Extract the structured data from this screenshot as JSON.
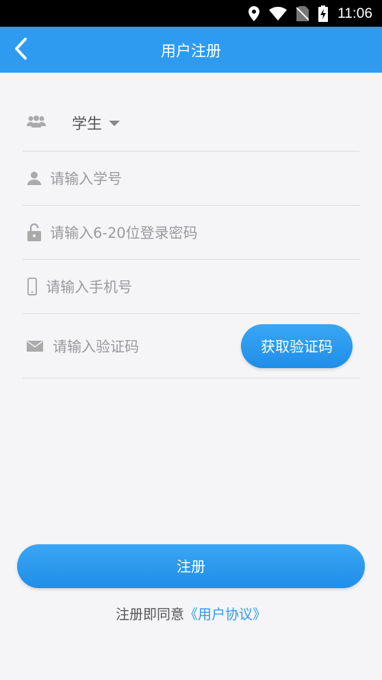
{
  "status_bar": {
    "time": "11:06"
  },
  "app_bar": {
    "title": "用户注册"
  },
  "form": {
    "role": {
      "selected": "学生"
    },
    "student_id": {
      "placeholder": "请输入学号"
    },
    "password": {
      "placeholder": "请输入6-20位登录密码"
    },
    "phone": {
      "placeholder": "请输入手机号"
    },
    "code": {
      "placeholder": "请输入验证码",
      "button_label": "获取验证码"
    }
  },
  "register_button": {
    "label": "注册"
  },
  "agreement": {
    "prefix": "注册即同意",
    "link": "《用户协议》"
  },
  "colors": {
    "primary": "#2e9bf0",
    "background": "#f5f5f8",
    "text": "#555555",
    "placeholder": "#9a9a9e"
  }
}
